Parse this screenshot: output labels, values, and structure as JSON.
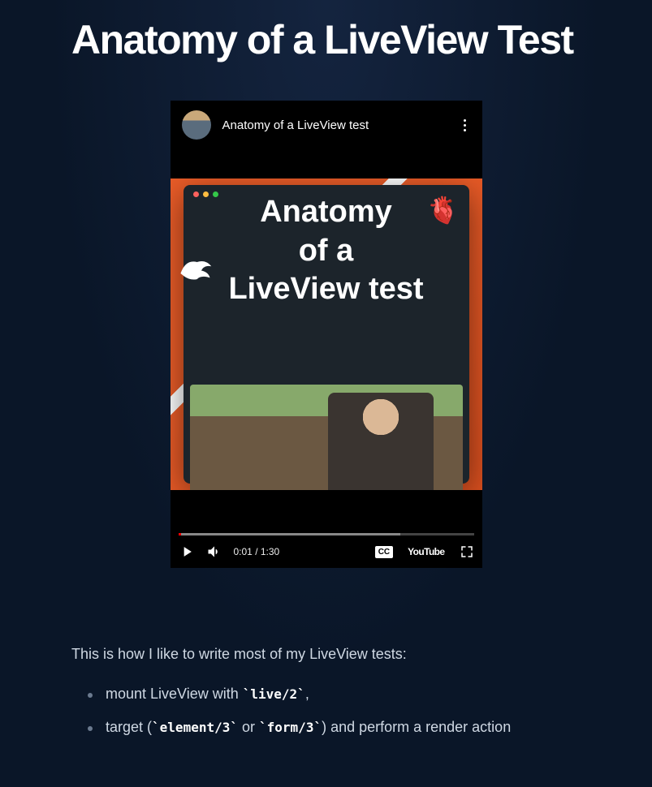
{
  "title": "Anatomy of a LiveView Test",
  "video": {
    "title": "Anatomy of a LiveView test",
    "overlay_line1": "Anatomy",
    "overlay_line2": "of a",
    "overlay_line3": "LiveView test",
    "time_current": "0:01",
    "time_total": "1:30",
    "cc_label": "CC",
    "youtube_label": "YouTube"
  },
  "body": {
    "intro": "This is how I like to write most of my LiveView tests:",
    "bullets": [
      {
        "pre": "mount LiveView with ",
        "code1": "`live/2`",
        "post": ","
      },
      {
        "pre": "target (",
        "code1": "`element/3`",
        "mid": " or ",
        "code2": "`form/3`",
        "post": ") and perform a render action"
      }
    ]
  }
}
